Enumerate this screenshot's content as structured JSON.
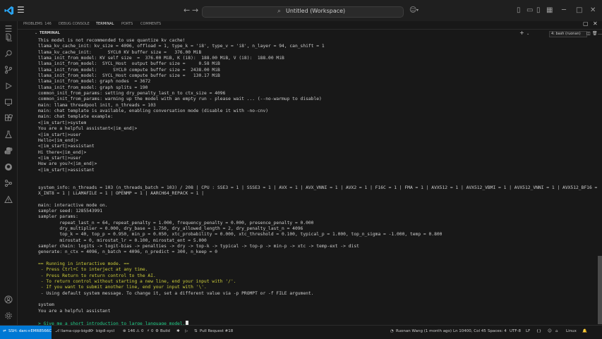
{
  "titlebar": {
    "menu_icon": "hamburger-menu",
    "search_text": "Untitled (Workspace)",
    "icons": [
      "back-arrow",
      "forward-arrow",
      "search-icon",
      "copilot-icon",
      "layout-icons",
      "window-controls"
    ]
  },
  "panel": {
    "tabs": [
      {
        "label": "PROBLEMS",
        "badge": "146"
      },
      {
        "label": "DEBUG CONSOLE"
      },
      {
        "label": "TERMINAL"
      },
      {
        "label": "PORTS"
      },
      {
        "label": "COMMENTS"
      }
    ],
    "terminal_title": "TERMINAL",
    "terminal_select": "4: bash (ruonan)"
  },
  "terminal": {
    "lines": [
      {
        "text": "This model is not recommended to use quantize kv cache!",
        "color": "default"
      },
      {
        "text": "llama_kv_cache_init: kv_size = 4096, offload = 1, type_k = 'i8', type_v = 'i8', n_layer = 94, can_shift = 1",
        "color": "default"
      },
      {
        "text": "llama_kv_cache_init:      SYCL0 KV buffer size =   376.00 MiB",
        "color": "default"
      },
      {
        "text": "llama_init_from_model: KV self size  =  376.00 MiB, K (i8):  188.00 MiB, V (i8):  188.00 MiB",
        "color": "default"
      },
      {
        "text": "llama_init_from_model:  SYCL_Host  output buffer size =     0.58 MiB",
        "color": "default"
      },
      {
        "text": "llama_init_from_model:      SYCL0 compute buffer size =  2438.00 MiB",
        "color": "default"
      },
      {
        "text": "llama_init_from_model:  SYCL_Host compute buffer size =   130.17 MiB",
        "color": "default"
      },
      {
        "text": "llama_init_from_model: graph nodes  = 3672",
        "color": "default"
      },
      {
        "text": "llama_init_from_model: graph splits = 190",
        "color": "default"
      },
      {
        "text": "common_init_from_params: setting dry_penalty_last_n to ctx_size = 4096",
        "color": "default"
      },
      {
        "text": "common_init_from_params: warming up the model with an empty run - please wait ... (--no-warmup to disable)",
        "color": "default"
      },
      {
        "text": "main: llama threadpool init, n_threads = 103",
        "color": "default"
      },
      {
        "text": "main: chat template is available, enabling conversation mode (disable it with -no-cnv)",
        "color": "default"
      },
      {
        "text": "main: chat template example:",
        "color": "default"
      },
      {
        "text": "<|im_start|>system",
        "color": "default"
      },
      {
        "text": "You are a helpful assistant<|im_end|>",
        "color": "default"
      },
      {
        "text": "<|im_start|>user",
        "color": "default"
      },
      {
        "text": "Hello<|im_end|>",
        "color": "default"
      },
      {
        "text": "<|im_start|>assistant",
        "color": "default"
      },
      {
        "text": "Hi there<|im_end|>",
        "color": "default"
      },
      {
        "text": "<|im_start|>user",
        "color": "default"
      },
      {
        "text": "How are you?<|im_end|>",
        "color": "default"
      },
      {
        "text": "<|im_start|>assistant",
        "color": "default"
      },
      {
        "text": "",
        "color": "default"
      },
      {
        "text": "",
        "color": "default"
      },
      {
        "text": "system_info: n_threads = 103 (n_threads_batch = 103) / 208 | CPU : SSE3 = 1 | SSSE3 = 1 | AVX = 1 | AVX_VNNI = 1 | AVX2 = 1 | F16C = 1 | FMA = 1 | AVX512 = 1 | AVX512_VBMI = 1 | AVX512_VNNI = 1 | AVX512_BF16 = 1 | AM",
        "color": "default"
      },
      {
        "text": "X_INT8 = 1 | LLAMAFILE = 1 | OPENMP = 1 | AARCH64_REPACK = 1 |",
        "color": "default"
      },
      {
        "text": "",
        "color": "default"
      },
      {
        "text": "main: interactive mode on.",
        "color": "default"
      },
      {
        "text": "sampler seed: 1285543991",
        "color": "default"
      },
      {
        "text": "sampler params:",
        "color": "default"
      },
      {
        "text": "        repeat_last_n = 64, repeat_penalty = 1.000, frequency_penalty = 0.000, presence_penalty = 0.000",
        "color": "default"
      },
      {
        "text": "        dry_multiplier = 0.000, dry_base = 1.750, dry_allowed_length = 2, dry_penalty_last_n = 4096",
        "color": "default"
      },
      {
        "text": "        top_k = 40, top_p = 0.950, min_p = 0.050, xtc_probability = 0.000, xtc_threshold = 0.100, typical_p = 1.000, top_n_sigma = -1.000, temp = 0.800",
        "color": "default"
      },
      {
        "text": "        mirostat = 0, mirostat_lr = 0.100, mirostat_ent = 5.000",
        "color": "default"
      },
      {
        "text": "sampler chain: logits -> logit-bias -> penalties -> dry -> top-k -> typical -> top-p -> min-p -> xtc -> temp-ext -> dist",
        "color": "default"
      },
      {
        "text": "generate: n_ctx = 4096, n_batch = 4096, n_predict = 300, n_keep = 0",
        "color": "default"
      },
      {
        "text": "",
        "color": "default"
      },
      {
        "text": "== Running in interactive mode. ==",
        "color": "yellow"
      },
      {
        "text": " - Press Ctrl+C to interject at any time.",
        "color": "yellow"
      },
      {
        "text": " - Press Return to return control to the AI.",
        "color": "yellow"
      },
      {
        "text": " - To return control without starting a new line, end your input with '/'.",
        "color": "yellow"
      },
      {
        "text": " - If you want to submit another line, end your input with '\\'.",
        "color": "yellow"
      },
      {
        "text": " - Using default system message. To change it, set a different value via -p PROMPT or -f FILE argument.",
        "color": "default"
      },
      {
        "text": "",
        "color": "default"
      },
      {
        "text": "system",
        "color": "default"
      },
      {
        "text": "You are a helpful assistant",
        "color": "default"
      },
      {
        "text": "",
        "color": "default"
      }
    ],
    "prompt": "> Give me a short introduction to large language model."
  },
  "statusbar": {
    "remote": "SSH: darc+EMR8566C",
    "branch": "llama-cpp-bigdl",
    "sync": "bigdl-sycl",
    "problems": "146",
    "warnings": "0",
    "ports": "0",
    "build": "Build",
    "pull_request": "Pull Request #18",
    "blame": "Ruonan Wang (1 month ago)",
    "position": "Ln 10400, Col 45",
    "spaces": "Spaces: 4",
    "encoding": "UTF-8",
    "eol": "LF",
    "braces": "{}",
    "os": "Linux"
  },
  "colors": {
    "accent": "#0078d4",
    "terminal_yellow": "#cdcd3a",
    "terminal_green": "#23d18b"
  }
}
